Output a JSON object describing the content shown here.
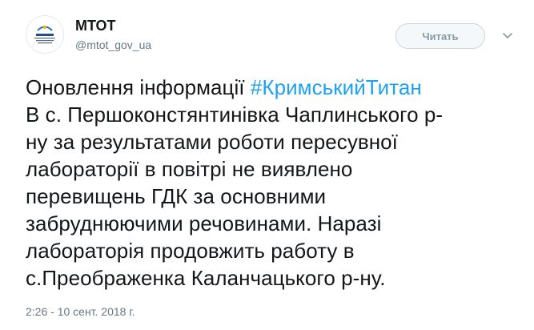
{
  "author": {
    "name": "МТОТ",
    "handle": "@mtot_gov_ua"
  },
  "follow_button": {
    "label": "Читать"
  },
  "tweet": {
    "line1_prefix": "Оновлення інформації ",
    "hashtag": "#КримськийТитан",
    "lines": [
      "В с. Першоконстянтинівка Чаплинського р-",
      "ну за результатами роботи пересувної",
      "лабораторії в повітрі не виявлено",
      "перевищень ГДК за основними",
      "забруднюючими речовинами. Наразі",
      "лабораторія продовжить работу в",
      "с.Преображенка Каланчацького р-ну."
    ]
  },
  "timestamp": "2:26 - 10 сент. 2018 г.",
  "colors": {
    "link": "#1da1f2",
    "text": "#14171a",
    "muted": "#657786"
  },
  "icons": {
    "avatar": "ministry-logo-icon",
    "menu": "chevron-down-icon"
  }
}
